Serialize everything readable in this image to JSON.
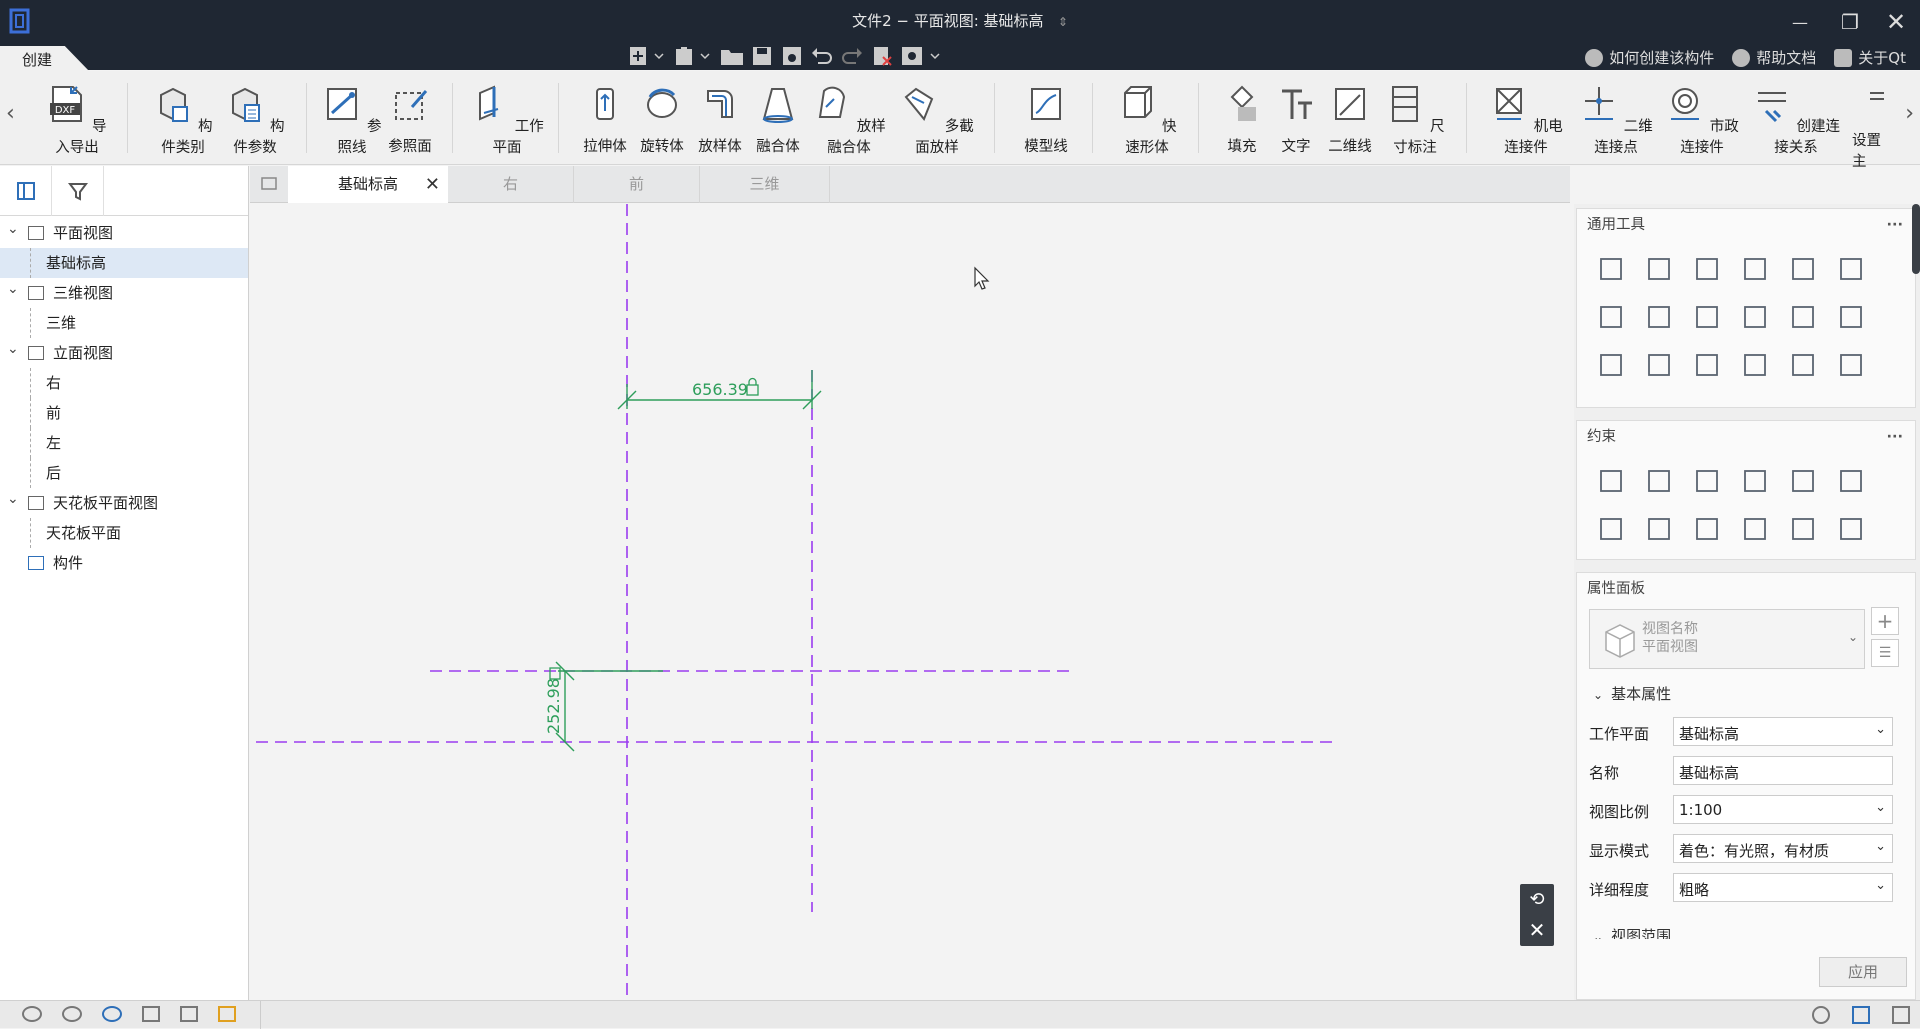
{
  "window": {
    "title": "文件2 − 平面视图: 基础标高",
    "title_suffix": "⇕",
    "minimize": "—",
    "maximize": "❐",
    "close": "✕"
  },
  "menu": {
    "tab": "创建"
  },
  "help_links": [
    "如何创建该构件",
    "帮助文档",
    "关于Qt"
  ],
  "ribbon": {
    "tools": [
      "导入导出",
      "构件类别",
      "构件参数",
      "参照线",
      "参照面",
      "工作平面",
      "拉伸体",
      "旋转体",
      "放样体",
      "融合体",
      "放样融合体",
      "多截面放样",
      "模型线",
      "快速形体",
      "填充",
      "文字",
      "二维线",
      "尺寸标注",
      "机电连接件",
      "二维连接点",
      "市政连接件",
      "创建连接关系",
      "设置主"
    ],
    "dxf_label": "DXF",
    "prev": "‹",
    "next": "›"
  },
  "tree": {
    "items": [
      {
        "label": "平面视图",
        "level": 0
      },
      {
        "label": "基础标高",
        "level": 1,
        "selected": true
      },
      {
        "label": "三维视图",
        "level": 0
      },
      {
        "label": "三维",
        "level": 1
      },
      {
        "label": "立面视图",
        "level": 0
      },
      {
        "label": "右",
        "level": 1
      },
      {
        "label": "前",
        "level": 1
      },
      {
        "label": "左",
        "level": 1
      },
      {
        "label": "后",
        "level": 1
      },
      {
        "label": "天花板平面视图",
        "level": 0
      },
      {
        "label": "天花板平面",
        "level": 1
      },
      {
        "label": "构件",
        "level": 0
      }
    ]
  },
  "view_tabs": [
    "基础标高",
    "右",
    "前",
    "三维"
  ],
  "canvas": {
    "dim_horizontal": "656.39",
    "dim_vertical": "252.98",
    "ref_line_color": "#9b3cf0",
    "dim_color": "#2e9e5b"
  },
  "right_panel": {
    "general_tools_title": "通用工具",
    "constraints_title": "约束",
    "properties_title": "属性面板",
    "view_name_label": "视图名称",
    "view_type": "平面视图",
    "basic_props_title": "基本属性",
    "properties": [
      {
        "label": "工作平面",
        "value": "基础标高",
        "dropdown": true
      },
      {
        "label": "名称",
        "value": "基础标高",
        "dropdown": false
      },
      {
        "label": "视图比例",
        "value": "1:100",
        "dropdown": true
      },
      {
        "label": "显示模式",
        "value": "着色：有光照，有材质",
        "dropdown": true
      },
      {
        "label": "详细程度",
        "value": "粗略",
        "dropdown": true
      }
    ],
    "view_range_title": "视图范围",
    "apply": "应用"
  },
  "colors": {
    "titlebar": "#1f2733",
    "accent": "#2e6fb8"
  }
}
